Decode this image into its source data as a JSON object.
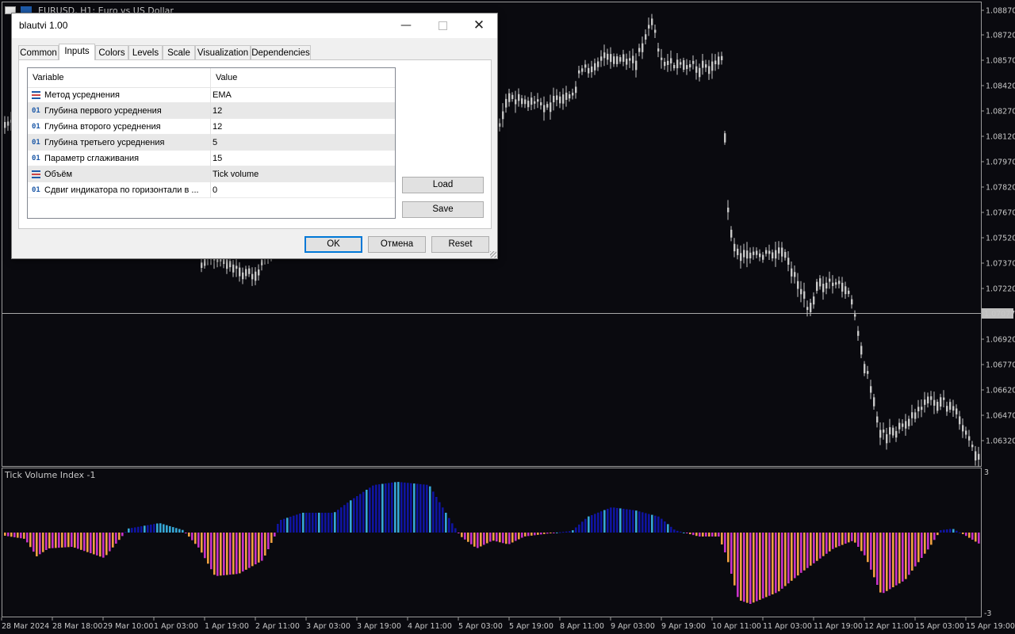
{
  "chart": {
    "symbol_title": "EURUSD, H1:  Euro vs US Dollar",
    "price_labels": [
      "1.08870",
      "1.08720",
      "1.08570",
      "1.08420",
      "1.08270",
      "1.08120",
      "1.07970",
      "1.07820",
      "1.07670",
      "1.07520",
      "1.07370",
      "1.07220",
      "1.06920",
      "1.06770",
      "1.06620",
      "1.06470",
      "1.06320"
    ],
    "current_price": "1.07077",
    "indicator_title": "Tick Volume Index -1",
    "indicator_scale_top": "3",
    "indicator_scale_bottom": "-3",
    "time_labels": [
      "28 Mar 2024",
      "28 Mar 18:00",
      "29 Mar 10:00",
      "1 Apr 03:00",
      "1 Apr 19:00",
      "2 Apr 11:00",
      "3 Apr 03:00",
      "3 Apr 19:00",
      "4 Apr 11:00",
      "5 Apr 03:00",
      "5 Apr 19:00",
      "8 Apr 11:00",
      "9 Apr 03:00",
      "9 Apr 19:00",
      "10 Apr 11:00",
      "11 Apr 03:00",
      "11 Apr 19:00",
      "12 Apr 11:00",
      "15 Apr 03:00",
      "15 Apr 19:00"
    ],
    "colors": {
      "background": "#0a0a0f",
      "candles": "#c8c8c8",
      "up_strong": "#0f14a0",
      "up_weak": "#36a7d6",
      "down_strong": "#c832c8",
      "down_weak": "#f0a040"
    }
  },
  "dialog": {
    "title": "blautvi 1.00",
    "tabs": [
      "Common",
      "Inputs",
      "Colors",
      "Levels",
      "Scale",
      "Visualization",
      "Dependencies"
    ],
    "active_tab": "Inputs",
    "grid_headers": {
      "variable": "Variable",
      "value": "Value"
    },
    "rows": [
      {
        "icon": "enum",
        "label": "Метод усреднения",
        "value": "EMA"
      },
      {
        "icon": "int",
        "label": "Глубина первого усреднения",
        "value": "12"
      },
      {
        "icon": "int",
        "label": "Глубина второго усреднения",
        "value": "12"
      },
      {
        "icon": "int",
        "label": "Глубина третьего усреднения",
        "value": "5"
      },
      {
        "icon": "int",
        "label": "Параметр сглаживания",
        "value": "15"
      },
      {
        "icon": "enum",
        "label": "Объём",
        "value": "Tick volume"
      },
      {
        "icon": "int",
        "label": "Сдвиг индикатора по горизонтали в ...",
        "value": "0"
      }
    ],
    "int_icon_text": "01",
    "load_label": "Load",
    "save_label": "Save",
    "ok_label": "OK",
    "cancel_label": "Отмена",
    "reset_label": "Reset"
  }
}
